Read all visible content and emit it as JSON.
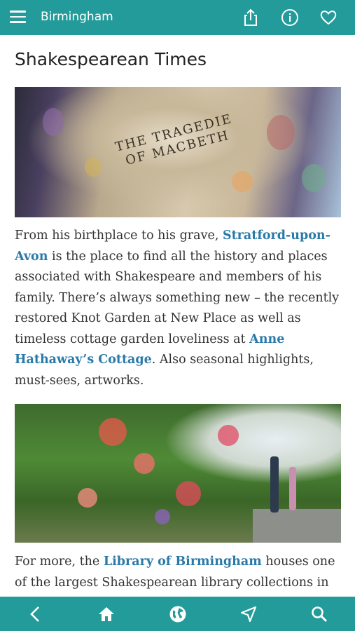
{
  "header": {
    "title": "Birmingham"
  },
  "page": {
    "heading": "Shakespearean Times",
    "paragraph1": {
      "before_link1": "From his birthplace to his grave, ",
      "link1": "Stratford-upon-Avon",
      "middle": " is the place to find all the history and places associated with Shakespeare and members of his family. There’s always something new – the recently restored Knot Garden at New Place as well as timeless cottage garden loveliness at ",
      "link2": "Anne Hathaway’s Cottage",
      "after_link2": ". Also seasonal highlights, must-sees, artworks."
    },
    "paragraph2": {
      "before_link": "For more, the ",
      "link": "Library of Birmingham",
      "after_link": " houses one of the largest Shakespearean library collections in the"
    },
    "image1_text": "THE TRAGEDIE OF MACBETH"
  },
  "icons": {
    "menu": "hamburger-icon",
    "share": "share-icon",
    "info": "info-icon",
    "favorite": "heart-icon",
    "back": "back-arrow-icon",
    "home": "home-icon",
    "web": "globe-icon",
    "navigate": "navigation-icon",
    "search": "search-icon"
  },
  "colors": {
    "bar": "#239b9a",
    "link": "#2a7aa8"
  }
}
